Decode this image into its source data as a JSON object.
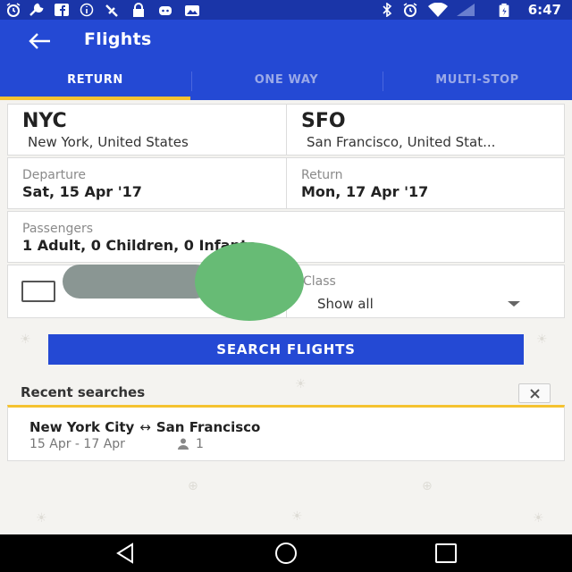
{
  "status_bar": {
    "time": "6:47",
    "left_icons": [
      "alarm-icon",
      "wrench-icon",
      "facebook-icon",
      "info-icon",
      "satellite-icon",
      "lock-icon",
      "bot-icon",
      "photo-icon"
    ],
    "right_icons": [
      "bluetooth-icon",
      "alarm-icon",
      "wifi-icon",
      "signal-icon",
      "battery-icon"
    ]
  },
  "app_bar": {
    "title": "Flights",
    "back_icon": "arrow-back-icon"
  },
  "tabs": [
    {
      "label": "RETURN",
      "active": true
    },
    {
      "label": "ONE WAY",
      "active": false
    },
    {
      "label": "MULTI-STOP",
      "active": false
    }
  ],
  "origin": {
    "code": "NYC",
    "city": "New York, United States"
  },
  "destination": {
    "code": "SFO",
    "city": "San Francisco, United Stat..."
  },
  "departure": {
    "label": "Departure",
    "value": "Sat, 15 Apr '17"
  },
  "return": {
    "label": "Return",
    "value": "Mon, 17 Apr '17"
  },
  "passengers": {
    "label": "Passengers",
    "value": "1 Adult, 0 Children, 0 Infants"
  },
  "cabin_class": {
    "label": "Class",
    "value": "Show all"
  },
  "search_button": "SEARCH FLIGHTS",
  "recent": {
    "title": "Recent searches",
    "items": [
      {
        "from": "New York City",
        "arrow": "↔",
        "to": "San Francisco",
        "dates": "15 Apr - 17 Apr",
        "passengers": "1"
      }
    ]
  },
  "colors": {
    "primary": "#2449d4",
    "status": "#1a35a8",
    "accent": "#f5c230",
    "toggle_knob": "#67bb75",
    "toggle_track": "#8a9693"
  }
}
